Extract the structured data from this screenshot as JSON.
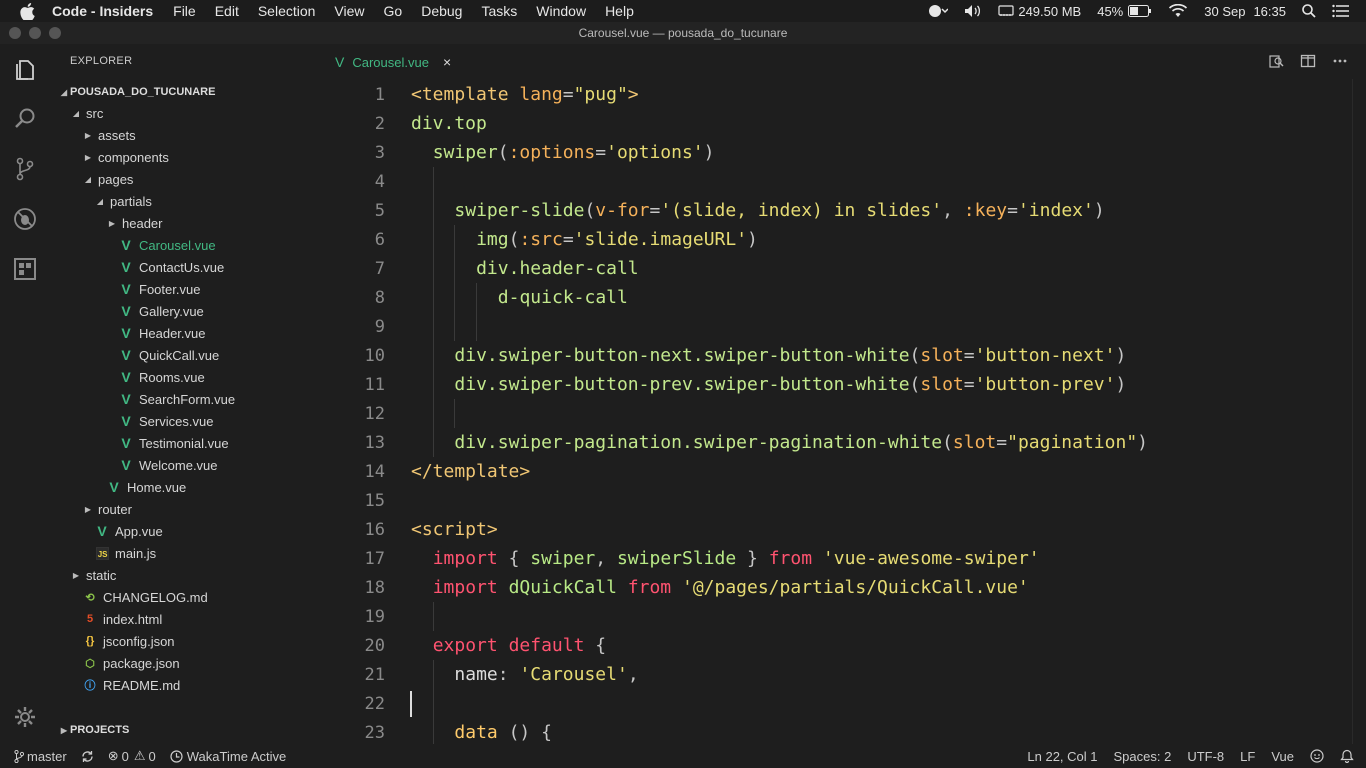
{
  "menubar": {
    "app_name": "Code - Insiders",
    "items": [
      "File",
      "Edit",
      "Selection",
      "View",
      "Go",
      "Debug",
      "Tasks",
      "Window",
      "Help"
    ],
    "memory": "249.50 MB",
    "battery": "45%",
    "date": "30 Sep",
    "time": "16:35"
  },
  "window": {
    "title": "Carousel.vue — pousada_do_tucunare"
  },
  "sidebar": {
    "title": "EXPLORER",
    "project_root": "POUSADA_DO_TUCUNARE",
    "projects_label": "PROJECTS",
    "tree": [
      {
        "label": "src",
        "depth": 1,
        "kind": "folder-open"
      },
      {
        "label": "assets",
        "depth": 2,
        "kind": "folder"
      },
      {
        "label": "components",
        "depth": 2,
        "kind": "folder"
      },
      {
        "label": "pages",
        "depth": 2,
        "kind": "folder-open"
      },
      {
        "label": "partials",
        "depth": 3,
        "kind": "folder-open"
      },
      {
        "label": "header",
        "depth": 4,
        "kind": "folder"
      },
      {
        "label": "Carousel.vue",
        "depth": 4,
        "kind": "vue",
        "active": true
      },
      {
        "label": "ContactUs.vue",
        "depth": 4,
        "kind": "vue"
      },
      {
        "label": "Footer.vue",
        "depth": 4,
        "kind": "vue"
      },
      {
        "label": "Gallery.vue",
        "depth": 4,
        "kind": "vue"
      },
      {
        "label": "Header.vue",
        "depth": 4,
        "kind": "vue"
      },
      {
        "label": "QuickCall.vue",
        "depth": 4,
        "kind": "vue"
      },
      {
        "label": "Rooms.vue",
        "depth": 4,
        "kind": "vue"
      },
      {
        "label": "SearchForm.vue",
        "depth": 4,
        "kind": "vue"
      },
      {
        "label": "Services.vue",
        "depth": 4,
        "kind": "vue"
      },
      {
        "label": "Testimonial.vue",
        "depth": 4,
        "kind": "vue"
      },
      {
        "label": "Welcome.vue",
        "depth": 4,
        "kind": "vue"
      },
      {
        "label": "Home.vue",
        "depth": 3,
        "kind": "vue"
      },
      {
        "label": "router",
        "depth": 2,
        "kind": "folder"
      },
      {
        "label": "App.vue",
        "depth": 2,
        "kind": "vue"
      },
      {
        "label": "main.js",
        "depth": 2,
        "kind": "js"
      },
      {
        "label": "static",
        "depth": 1,
        "kind": "folder"
      },
      {
        "label": "CHANGELOG.md",
        "depth": 1,
        "kind": "changelog"
      },
      {
        "label": "index.html",
        "depth": 1,
        "kind": "html"
      },
      {
        "label": "jsconfig.json",
        "depth": 1,
        "kind": "json"
      },
      {
        "label": "package.json",
        "depth": 1,
        "kind": "package"
      },
      {
        "label": "README.md",
        "depth": 1,
        "kind": "readme"
      }
    ]
  },
  "tab": {
    "label": "Carousel.vue",
    "close": "×"
  },
  "editor": {
    "lines": [
      {
        "n": "1",
        "indent": 0,
        "tokens": [
          [
            "tag",
            "<template"
          ],
          [
            "plain",
            " "
          ],
          [
            "attr",
            "lang"
          ],
          [
            "punc",
            "="
          ],
          [
            "str",
            "\"pug\""
          ],
          [
            "tag",
            ">"
          ]
        ]
      },
      {
        "n": "2",
        "indent": 0,
        "tokens": [
          [
            "sel",
            "div.top"
          ]
        ]
      },
      {
        "n": "3",
        "indent": 1,
        "tokens": [
          [
            "sel",
            "swiper"
          ],
          [
            "punc",
            "("
          ],
          [
            "attr",
            ":options"
          ],
          [
            "punc",
            "="
          ],
          [
            "str",
            "'options'"
          ],
          [
            "punc",
            ")"
          ]
        ]
      },
      {
        "n": "4",
        "indent": 0,
        "tokens": []
      },
      {
        "n": "5",
        "indent": 2,
        "tokens": [
          [
            "sel",
            "swiper-slide"
          ],
          [
            "punc",
            "("
          ],
          [
            "attr",
            "v-for"
          ],
          [
            "punc",
            "="
          ],
          [
            "str",
            "'(slide, index) in slides'"
          ],
          [
            "punc",
            ", "
          ],
          [
            "attr",
            ":key"
          ],
          [
            "punc",
            "="
          ],
          [
            "str",
            "'index'"
          ],
          [
            "punc",
            ")"
          ]
        ]
      },
      {
        "n": "6",
        "indent": 3,
        "tokens": [
          [
            "sel",
            "img"
          ],
          [
            "punc",
            "("
          ],
          [
            "attr",
            ":src"
          ],
          [
            "punc",
            "="
          ],
          [
            "str",
            "'slide.imageURL'"
          ],
          [
            "punc",
            ")"
          ]
        ]
      },
      {
        "n": "7",
        "indent": 3,
        "tokens": [
          [
            "sel",
            "div.header-call"
          ]
        ]
      },
      {
        "n": "8",
        "indent": 4,
        "tokens": [
          [
            "sel",
            "d-quick-call"
          ]
        ]
      },
      {
        "n": "9",
        "indent": 0,
        "tokens": []
      },
      {
        "n": "10",
        "indent": 2,
        "tokens": [
          [
            "sel",
            "div.swiper-button-next.swiper-button-white"
          ],
          [
            "punc",
            "("
          ],
          [
            "attr",
            "slot"
          ],
          [
            "punc",
            "="
          ],
          [
            "str",
            "'button-next'"
          ],
          [
            "punc",
            ")"
          ]
        ]
      },
      {
        "n": "11",
        "indent": 2,
        "tokens": [
          [
            "sel",
            "div.swiper-button-prev.swiper-button-white"
          ],
          [
            "punc",
            "("
          ],
          [
            "attr",
            "slot"
          ],
          [
            "punc",
            "="
          ],
          [
            "str",
            "'button-prev'"
          ],
          [
            "punc",
            ")"
          ]
        ]
      },
      {
        "n": "12",
        "indent": 0,
        "tokens": []
      },
      {
        "n": "13",
        "indent": 2,
        "tokens": [
          [
            "sel",
            "div.swiper-pagination.swiper-pagination-white"
          ],
          [
            "punc",
            "("
          ],
          [
            "attr",
            "slot"
          ],
          [
            "punc",
            "="
          ],
          [
            "str",
            "\"pagination\""
          ],
          [
            "punc",
            ")"
          ]
        ]
      },
      {
        "n": "14",
        "indent": 0,
        "tokens": [
          [
            "tag",
            "</template>"
          ]
        ]
      },
      {
        "n": "15",
        "indent": 0,
        "tokens": []
      },
      {
        "n": "16",
        "indent": 0,
        "tokens": [
          [
            "tag",
            "<script>"
          ]
        ]
      },
      {
        "n": "17",
        "indent": 1,
        "tokens": [
          [
            "kw",
            "import"
          ],
          [
            "plain",
            " "
          ],
          [
            "punc",
            "{ "
          ],
          [
            "comp",
            "swiper"
          ],
          [
            "punc",
            ", "
          ],
          [
            "comp",
            "swiperSlide"
          ],
          [
            "punc",
            " } "
          ],
          [
            "kw",
            "from"
          ],
          [
            "plain",
            " "
          ],
          [
            "str",
            "'vue-awesome-swiper'"
          ]
        ]
      },
      {
        "n": "18",
        "indent": 1,
        "tokens": [
          [
            "kw",
            "import"
          ],
          [
            "plain",
            " "
          ],
          [
            "comp",
            "dQuickCall"
          ],
          [
            "plain",
            " "
          ],
          [
            "kw",
            "from"
          ],
          [
            "plain",
            " "
          ],
          [
            "str",
            "'@/pages/partials/QuickCall.vue'"
          ]
        ]
      },
      {
        "n": "19",
        "indent": 0,
        "tokens": []
      },
      {
        "n": "20",
        "indent": 1,
        "tokens": [
          [
            "kw",
            "export"
          ],
          [
            "plain",
            " "
          ],
          [
            "kw",
            "default"
          ],
          [
            "plain",
            " "
          ],
          [
            "punc",
            "{"
          ]
        ]
      },
      {
        "n": "21",
        "indent": 2,
        "tokens": [
          [
            "plain",
            "name"
          ],
          [
            "punc",
            ": "
          ],
          [
            "str",
            "'Carousel'"
          ],
          [
            "punc",
            ","
          ]
        ]
      },
      {
        "n": "22",
        "indent": 0,
        "tokens": []
      },
      {
        "n": "23",
        "indent": 2,
        "tokens": [
          [
            "fn",
            "data"
          ],
          [
            "plain",
            " "
          ],
          [
            "punc",
            "() {"
          ]
        ]
      }
    ],
    "cursor_line": "22"
  },
  "statusbar": {
    "branch": "master",
    "errors": "0",
    "warnings": "0",
    "wakatime": "WakaTime Active",
    "position": "Ln 22, Col 1",
    "spaces": "Spaces: 2",
    "encoding": "UTF-8",
    "eol": "LF",
    "language": "Vue"
  }
}
